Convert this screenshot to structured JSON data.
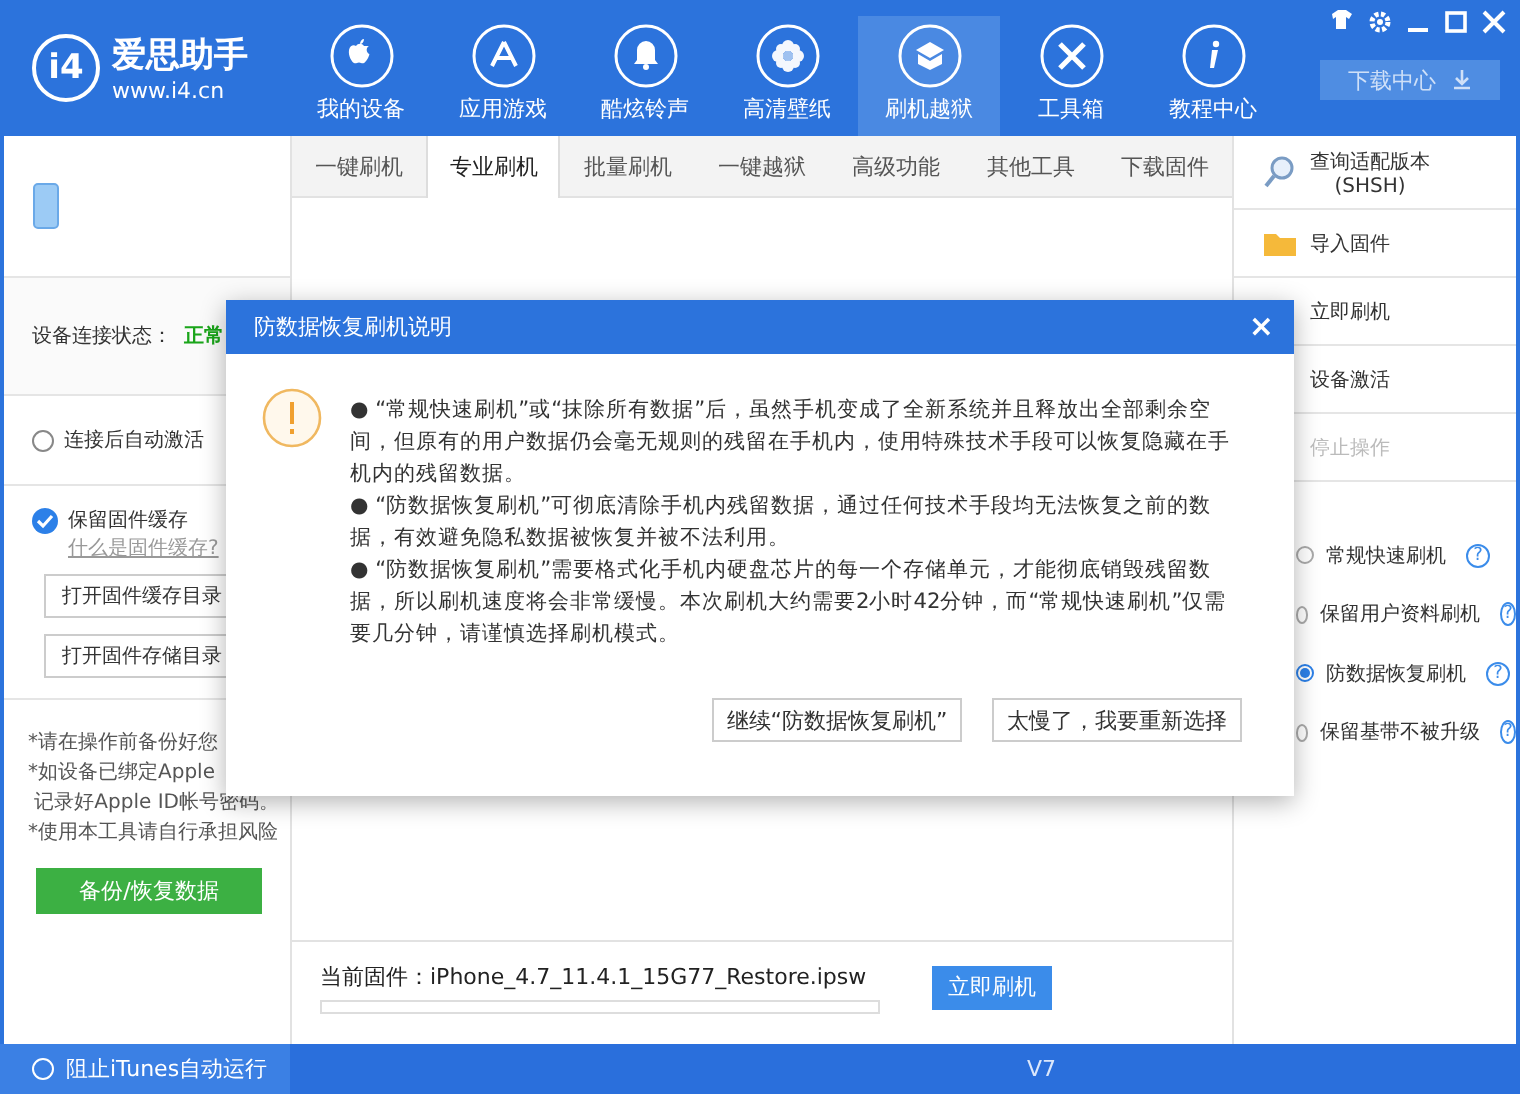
{
  "header": {
    "logo_mark": "i4",
    "logo_title": "爱思助手",
    "logo_url": "www.i4.cn",
    "nav": [
      {
        "label": "我的设备",
        "selected": false
      },
      {
        "label": "应用游戏",
        "selected": false
      },
      {
        "label": "酷炫铃声",
        "selected": false
      },
      {
        "label": "高清壁纸",
        "selected": false
      },
      {
        "label": "刷机越狱",
        "selected": true
      },
      {
        "label": "工具箱",
        "selected": false
      },
      {
        "label": "教程中心",
        "selected": false
      }
    ],
    "download_button": "下载中心"
  },
  "sidebar": {
    "connection_label": "设备连接状态：",
    "connection_status": "正常",
    "auto_activate": {
      "label": "连接后自动激活",
      "checked": false
    },
    "keep_cache": {
      "label": "保留固件缓存",
      "checked": true
    },
    "cache_help_link": "什么是固件缓存?",
    "buttons": [
      "打开固件缓存目录",
      "打开固件存储目录"
    ],
    "notes": [
      "*请在操作前备份好您",
      "*如设备已绑定Apple",
      " 记录好Apple ID帐号密码。",
      "*使用本工具请自行承担风险"
    ],
    "backup_button": "备份/恢复数据"
  },
  "tabs": [
    {
      "label": "一键刷机",
      "selected": false
    },
    {
      "label": "专业刷机",
      "selected": true
    },
    {
      "label": "批量刷机",
      "selected": false
    },
    {
      "label": "一键越狱",
      "selected": false
    },
    {
      "label": "高级功能",
      "selected": false
    },
    {
      "label": "其他工具",
      "selected": false
    },
    {
      "label": "下载固件",
      "selected": false
    }
  ],
  "firmware": {
    "label": "当前固件：iPhone_4.7_11.4.1_15G77_Restore.ipsw",
    "level": 0,
    "flash_button": "立即刷机"
  },
  "right_panel": {
    "actions": [
      {
        "label": "查询适配版本",
        "sublabel": "(SHSH)",
        "disabled": false
      },
      {
        "label": "导入固件",
        "disabled": false
      },
      {
        "label": "立即刷机",
        "disabled": false
      },
      {
        "label": "设备激活",
        "disabled": false
      },
      {
        "label": "停止操作",
        "disabled": true
      }
    ],
    "modes": [
      {
        "label": "常规快速刷机",
        "help": "?",
        "selected": false
      },
      {
        "label": "保留用户资料刷机",
        "help": "?",
        "selected": false
      },
      {
        "label": "防数据恢复刷机",
        "help": "?",
        "selected": true
      },
      {
        "label": "保留基带不被升级",
        "help": "?",
        "selected": false
      }
    ]
  },
  "dialog": {
    "title": "防数据恢复刷机说明",
    "close": "×",
    "paragraphs": [
      "●  “常规快速刷机”或“抹除所有数据”后，虽然手机变成了全新系统并且释放出全部剩余空间，但原有的用户数据仍会毫无规则的残留在手机内，使用特殊技术手段可以恢复隐藏在手机内的残留数据。",
      "●  “防数据恢复刷机”可彻底清除手机内残留数据，通过任何技术手段均无法恢复之前的数据，有效避免隐私数据被恢复并被不法利用。",
      "●  “防数据恢复刷机”需要格式化手机内硬盘芯片的每一个存储单元，才能彻底销毁残留数据，所以刷机速度将会非常缓慢。本次刷机大约需要2小时42分钟，而“常规快速刷机”仅需要几分钟，请谨慎选择刷机模式。"
    ],
    "buttons": [
      "继续“防数据恢复刷机”",
      "太慢了，我要重新选择"
    ]
  },
  "status_bar": {
    "itunes_block": {
      "label": "阻止iTunes自动运行",
      "checked": false
    },
    "version": "V7"
  }
}
